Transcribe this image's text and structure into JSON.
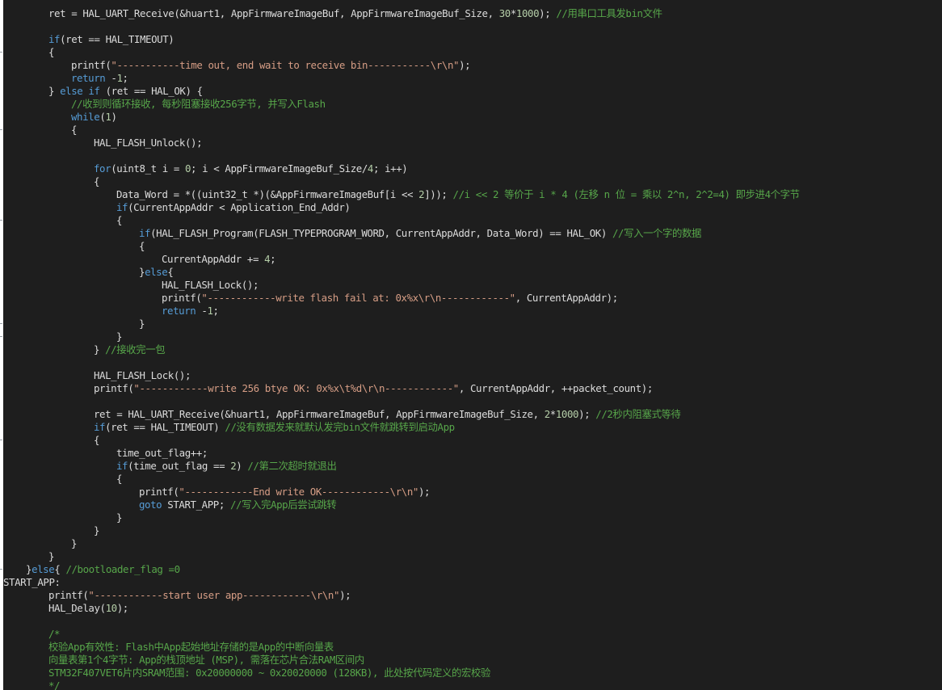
{
  "editor": {
    "theme": {
      "background": "#1e1e1e",
      "plain": "#dcdcdc",
      "keyword": "#569cd6",
      "number": "#b5cea8",
      "string": "#d69d85",
      "comment": "#57a64a"
    },
    "lines": [
      {
        "indent": 56,
        "tokens": [
          {
            "t": "plain",
            "v": "ret = HAL_UART_Receive(&huart1, AppFirmwareImageBuf, AppFirmwareImageBuf_Size, "
          },
          {
            "t": "number",
            "v": "30"
          },
          {
            "t": "plain",
            "v": "*"
          },
          {
            "t": "number",
            "v": "1000"
          },
          {
            "t": "plain",
            "v": "); "
          },
          {
            "t": "comment",
            "v": "//用串口工具发bin文件"
          }
        ]
      },
      {
        "indent": 0,
        "tokens": []
      },
      {
        "indent": 56,
        "tokens": [
          {
            "t": "keyword",
            "v": "if"
          },
          {
            "t": "plain",
            "v": "(ret == HAL_TIMEOUT)"
          }
        ]
      },
      {
        "indent": 56,
        "tokens": [
          {
            "t": "plain",
            "v": "{"
          }
        ]
      },
      {
        "indent": 84,
        "tokens": [
          {
            "t": "plain",
            "v": "printf("
          },
          {
            "t": "string",
            "v": "\"-----------time out, end wait to receive bin-----------\\r\\n\""
          },
          {
            "t": "plain",
            "v": ");"
          }
        ]
      },
      {
        "indent": 84,
        "tokens": [
          {
            "t": "keyword",
            "v": "return"
          },
          {
            "t": "plain",
            "v": " -"
          },
          {
            "t": "number",
            "v": "1"
          },
          {
            "t": "plain",
            "v": ";"
          }
        ]
      },
      {
        "indent": 56,
        "tokens": [
          {
            "t": "plain",
            "v": "} "
          },
          {
            "t": "keyword",
            "v": "else if"
          },
          {
            "t": "plain",
            "v": " (ret == HAL_OK) {"
          }
        ]
      },
      {
        "indent": 84,
        "tokens": [
          {
            "t": "comment",
            "v": "//收到则循环接收, 每秒阻塞接收256字节, 并写入Flash"
          }
        ]
      },
      {
        "indent": 84,
        "tokens": [
          {
            "t": "keyword",
            "v": "while"
          },
          {
            "t": "plain",
            "v": "("
          },
          {
            "t": "number",
            "v": "1"
          },
          {
            "t": "plain",
            "v": ")"
          }
        ]
      },
      {
        "indent": 84,
        "tokens": [
          {
            "t": "plain",
            "v": "{"
          }
        ]
      },
      {
        "indent": 112,
        "tokens": [
          {
            "t": "plain",
            "v": "HAL_FLASH_Unlock();"
          }
        ]
      },
      {
        "indent": 0,
        "tokens": []
      },
      {
        "indent": 112,
        "tokens": [
          {
            "t": "keyword",
            "v": "for"
          },
          {
            "t": "plain",
            "v": "(uint8_t i = "
          },
          {
            "t": "number",
            "v": "0"
          },
          {
            "t": "plain",
            "v": "; i < AppFirmwareImageBuf_Size/"
          },
          {
            "t": "number",
            "v": "4"
          },
          {
            "t": "plain",
            "v": "; i++)"
          }
        ]
      },
      {
        "indent": 112,
        "tokens": [
          {
            "t": "plain",
            "v": "{"
          }
        ]
      },
      {
        "indent": 140,
        "tokens": [
          {
            "t": "plain",
            "v": "Data_Word = *((uint32_t *)(&AppFirmwareImageBuf[i << "
          },
          {
            "t": "number",
            "v": "2"
          },
          {
            "t": "plain",
            "v": "])); "
          },
          {
            "t": "comment",
            "v": "//i << 2 等价于 i * 4 (左移 n 位 = 乘以 2^n, 2^2=4) 即步进4个字节"
          }
        ]
      },
      {
        "indent": 140,
        "tokens": [
          {
            "t": "keyword",
            "v": "if"
          },
          {
            "t": "plain",
            "v": "(CurrentAppAddr < Application_End_Addr)"
          }
        ]
      },
      {
        "indent": 140,
        "tokens": [
          {
            "t": "plain",
            "v": "{"
          }
        ]
      },
      {
        "indent": 168,
        "tokens": [
          {
            "t": "keyword",
            "v": "if"
          },
          {
            "t": "plain",
            "v": "(HAL_FLASH_Program(FLASH_TYPEPROGRAM_WORD, CurrentAppAddr, Data_Word) == HAL_OK) "
          },
          {
            "t": "comment",
            "v": "//写入一个字的数据"
          }
        ]
      },
      {
        "indent": 168,
        "tokens": [
          {
            "t": "plain",
            "v": "{"
          }
        ]
      },
      {
        "indent": 196,
        "tokens": [
          {
            "t": "plain",
            "v": "CurrentAppAddr += "
          },
          {
            "t": "number",
            "v": "4"
          },
          {
            "t": "plain",
            "v": ";"
          }
        ]
      },
      {
        "indent": 168,
        "tokens": [
          {
            "t": "plain",
            "v": "}"
          },
          {
            "t": "keyword",
            "v": "else"
          },
          {
            "t": "plain",
            "v": "{"
          }
        ]
      },
      {
        "indent": 196,
        "tokens": [
          {
            "t": "plain",
            "v": "HAL_FLASH_Lock();"
          }
        ]
      },
      {
        "indent": 196,
        "tokens": [
          {
            "t": "plain",
            "v": "printf("
          },
          {
            "t": "string",
            "v": "\"------------write flash fail at: 0x%x\\r\\n------------\""
          },
          {
            "t": "plain",
            "v": ", CurrentAppAddr);"
          }
        ]
      },
      {
        "indent": 196,
        "tokens": [
          {
            "t": "keyword",
            "v": "return"
          },
          {
            "t": "plain",
            "v": " -"
          },
          {
            "t": "number",
            "v": "1"
          },
          {
            "t": "plain",
            "v": ";"
          }
        ]
      },
      {
        "indent": 168,
        "tokens": [
          {
            "t": "plain",
            "v": "}"
          }
        ]
      },
      {
        "indent": 140,
        "tokens": [
          {
            "t": "plain",
            "v": "}"
          }
        ]
      },
      {
        "indent": 112,
        "tokens": [
          {
            "t": "plain",
            "v": "} "
          },
          {
            "t": "comment",
            "v": "//接收完一包"
          }
        ]
      },
      {
        "indent": 0,
        "tokens": []
      },
      {
        "indent": 112,
        "tokens": [
          {
            "t": "plain",
            "v": "HAL_FLASH_Lock();"
          }
        ]
      },
      {
        "indent": 112,
        "tokens": [
          {
            "t": "plain",
            "v": "printf("
          },
          {
            "t": "string",
            "v": "\"------------write 256 btye OK: 0x%x\\t%d\\r\\n------------\""
          },
          {
            "t": "plain",
            "v": ", CurrentAppAddr, ++packet_count);"
          }
        ]
      },
      {
        "indent": 0,
        "tokens": []
      },
      {
        "indent": 112,
        "tokens": [
          {
            "t": "plain",
            "v": "ret = HAL_UART_Receive(&huart1, AppFirmwareImageBuf, AppFirmwareImageBuf_Size, "
          },
          {
            "t": "number",
            "v": "2"
          },
          {
            "t": "plain",
            "v": "*"
          },
          {
            "t": "number",
            "v": "1000"
          },
          {
            "t": "plain",
            "v": "); "
          },
          {
            "t": "comment",
            "v": "//2秒内阻塞式等待"
          }
        ]
      },
      {
        "indent": 112,
        "tokens": [
          {
            "t": "keyword",
            "v": "if"
          },
          {
            "t": "plain",
            "v": "(ret == HAL_TIMEOUT) "
          },
          {
            "t": "comment",
            "v": "//没有数据发来就默认发完bin文件就跳转到启动App"
          }
        ]
      },
      {
        "indent": 112,
        "tokens": [
          {
            "t": "plain",
            "v": "{"
          }
        ]
      },
      {
        "indent": 140,
        "tokens": [
          {
            "t": "plain",
            "v": "time_out_flag++;"
          }
        ]
      },
      {
        "indent": 140,
        "tokens": [
          {
            "t": "keyword",
            "v": "if"
          },
          {
            "t": "plain",
            "v": "(time_out_flag == "
          },
          {
            "t": "number",
            "v": "2"
          },
          {
            "t": "plain",
            "v": ") "
          },
          {
            "t": "comment",
            "v": "//第二次超时就退出"
          }
        ]
      },
      {
        "indent": 140,
        "tokens": [
          {
            "t": "plain",
            "v": "{"
          }
        ]
      },
      {
        "indent": 168,
        "tokens": [
          {
            "t": "plain",
            "v": "printf("
          },
          {
            "t": "string",
            "v": "\"------------End write OK------------\\r\\n\""
          },
          {
            "t": "plain",
            "v": ");"
          }
        ]
      },
      {
        "indent": 168,
        "tokens": [
          {
            "t": "keyword",
            "v": "goto"
          },
          {
            "t": "plain",
            "v": " START_APP; "
          },
          {
            "t": "comment",
            "v": "//写入完App后尝试跳转"
          }
        ]
      },
      {
        "indent": 140,
        "tokens": [
          {
            "t": "plain",
            "v": "}"
          }
        ]
      },
      {
        "indent": 112,
        "tokens": [
          {
            "t": "plain",
            "v": "}"
          }
        ]
      },
      {
        "indent": 84,
        "tokens": [
          {
            "t": "plain",
            "v": "}"
          }
        ]
      },
      {
        "indent": 56,
        "tokens": [
          {
            "t": "plain",
            "v": "}"
          }
        ]
      },
      {
        "indent": 28,
        "tokens": [
          {
            "t": "plain",
            "v": "}"
          },
          {
            "t": "keyword",
            "v": "else"
          },
          {
            "t": "plain",
            "v": "{ "
          },
          {
            "t": "comment",
            "v": "//bootloader_flag =0"
          }
        ]
      },
      {
        "indent": 0,
        "tokens": [
          {
            "t": "label",
            "v": "START_APP:"
          }
        ]
      },
      {
        "indent": 56,
        "tokens": [
          {
            "t": "plain",
            "v": "printf("
          },
          {
            "t": "string",
            "v": "\"------------start user app------------\\r\\n\""
          },
          {
            "t": "plain",
            "v": ");"
          }
        ]
      },
      {
        "indent": 56,
        "tokens": [
          {
            "t": "plain",
            "v": "HAL_Delay("
          },
          {
            "t": "number",
            "v": "10"
          },
          {
            "t": "plain",
            "v": ");"
          }
        ]
      },
      {
        "indent": 0,
        "tokens": []
      },
      {
        "indent": 56,
        "tokens": [
          {
            "t": "comment",
            "v": "/*"
          }
        ]
      },
      {
        "indent": 56,
        "tokens": [
          {
            "t": "comment",
            "v": "校验App有效性: Flash中App起始地址存储的是App的中断向量表"
          }
        ]
      },
      {
        "indent": 56,
        "tokens": [
          {
            "t": "comment",
            "v": "向量表第1个4字节: App的栈顶地址 (MSP), 需落在芯片合法RAM区间内"
          }
        ]
      },
      {
        "indent": 56,
        "tokens": [
          {
            "t": "comment",
            "v": "STM32F407VET6片内SRAM范围: 0x20000000 ~ 0x20020000 (128KB), 此处按代码定义的宏校验"
          }
        ]
      },
      {
        "indent": 56,
        "tokens": [
          {
            "t": "comment",
            "v": "*/"
          }
        ]
      }
    ]
  }
}
